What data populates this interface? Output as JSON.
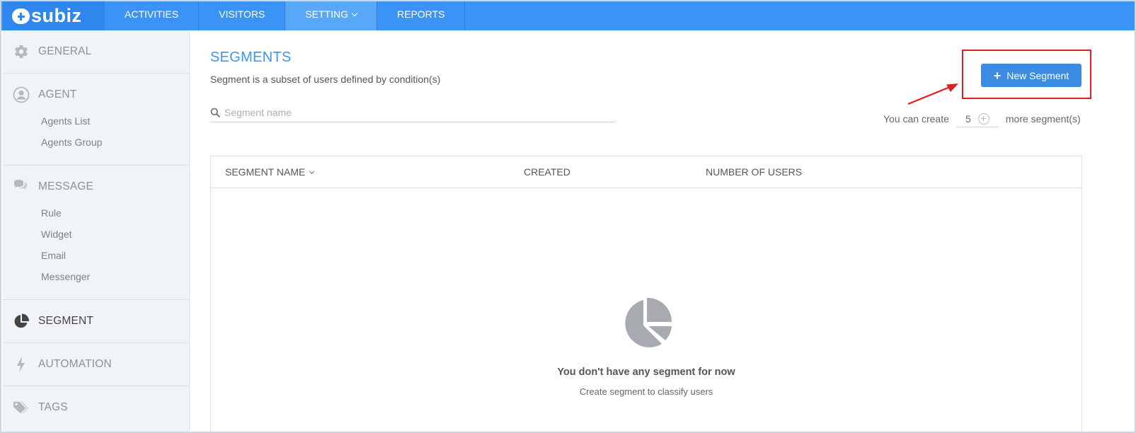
{
  "app": {
    "logo_text": "subiz"
  },
  "nav": [
    {
      "label": "ACTIVITIES"
    },
    {
      "label": "VISITORS"
    },
    {
      "label": "SETTING"
    },
    {
      "label": "REPORTS"
    }
  ],
  "sidebar": {
    "general": "GENERAL",
    "agent": "AGENT",
    "agent_items": [
      "Agents List",
      "Agents Group"
    ],
    "message": "MESSAGE",
    "message_items": [
      "Rule",
      "Widget",
      "Email",
      "Messenger"
    ],
    "segment": "SEGMENT",
    "automation": "AUTOMATION",
    "tags": "TAGS"
  },
  "page": {
    "title": "SEGMENTS",
    "subtitle": "Segment is a subset of users defined by condition(s)",
    "search_placeholder": "Segment name",
    "new_button": "New Segment",
    "quota_prefix": "You can create",
    "quota_value": "5",
    "quota_suffix": "more segment(s)"
  },
  "table": {
    "columns": [
      "SEGMENT NAME",
      "CREATED",
      "NUMBER OF USERS"
    ],
    "empty_title": "You don't have any segment for now",
    "empty_subtitle": "Create segment to classify users"
  },
  "colors": {
    "brand": "#3b94f5",
    "button": "#3b8ce2",
    "annotation": "#e31c1c"
  }
}
